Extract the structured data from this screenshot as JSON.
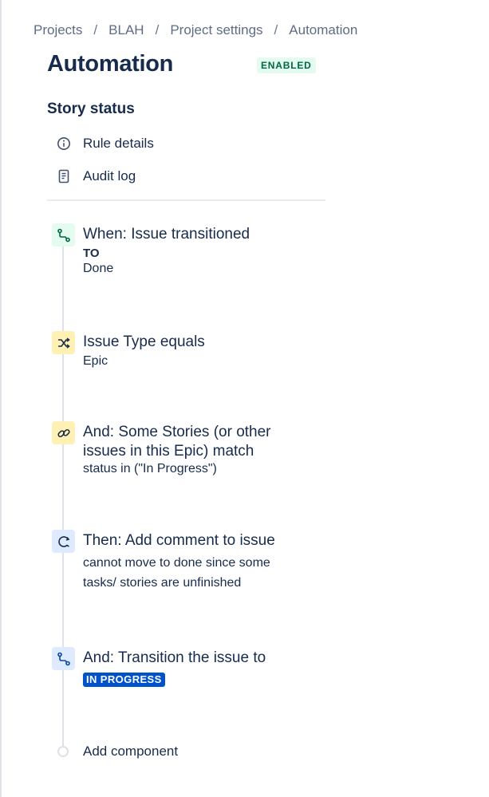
{
  "breadcrumb": {
    "items": [
      "Projects",
      "BLAH",
      "Project settings",
      "Automation"
    ],
    "separator": "/"
  },
  "header": {
    "title": "Automation",
    "status": "ENABLED"
  },
  "rule": {
    "name": "Story status",
    "menu": [
      {
        "label": "Rule details",
        "icon": "info-icon"
      },
      {
        "label": "Audit log",
        "icon": "audit-log-icon"
      }
    ]
  },
  "steps": [
    {
      "icon": "transition-icon",
      "color": "#e3fcef",
      "heading": "When: Issue transitioned",
      "sub_small": "TO",
      "sub": "Done"
    },
    {
      "icon": "shuffle-icon",
      "color": "#fff0b3",
      "heading": "Issue Type equals",
      "sub": "Epic"
    },
    {
      "icon": "link-icon",
      "color": "#fff0b3",
      "heading_line1": "And: Some Stories (or other",
      "heading_line2": "issues in this Epic) match",
      "sub": "status in (\"In Progress\")"
    },
    {
      "icon": "comment-icon",
      "color": "#deebff",
      "heading": "Then: Add comment to issue",
      "sub_line1": "cannot move to done since some",
      "sub_line2": "tasks/ stories are unfinished"
    },
    {
      "icon": "transition-icon",
      "color": "#deebff",
      "heading": "And: Transition the issue to",
      "lozenge": "IN PROGRESS",
      "lozenge_color": "#0052cc"
    }
  ],
  "add_component": {
    "label": "Add component"
  }
}
